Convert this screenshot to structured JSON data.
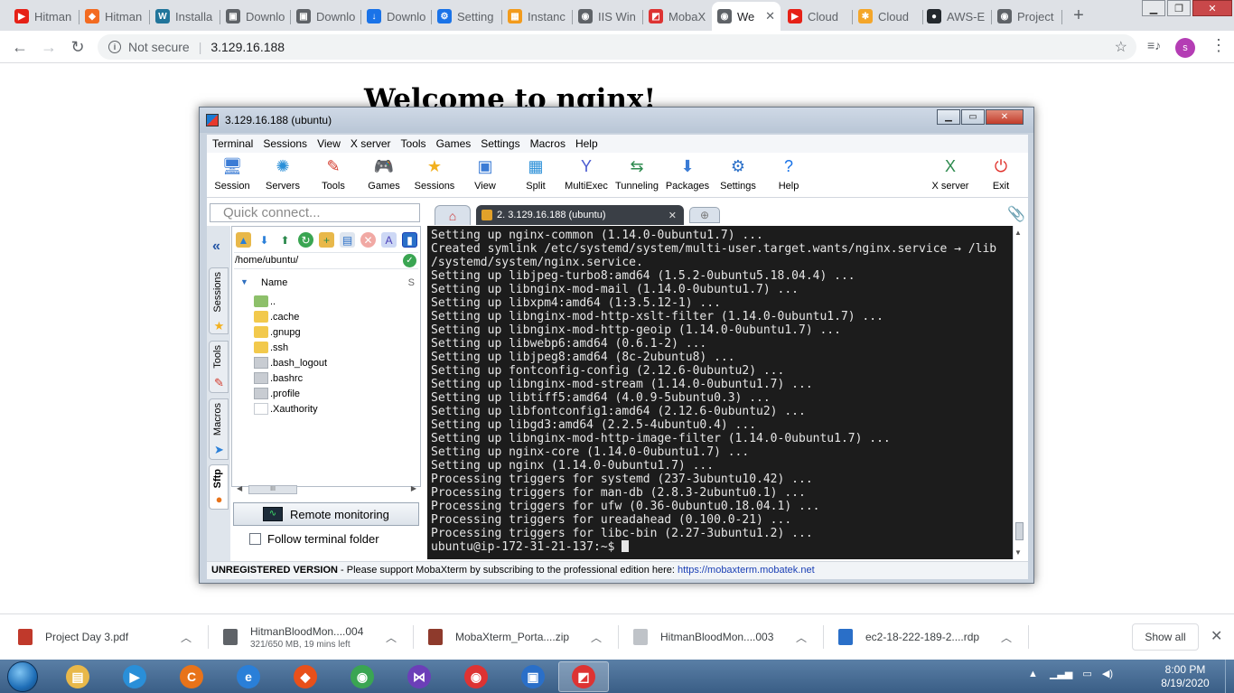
{
  "browser": {
    "tabs": [
      {
        "title": "Hitman",
        "color": "#e62117",
        "glyph": "▶"
      },
      {
        "title": "Hitman",
        "color": "#f36b21",
        "glyph": "◆"
      },
      {
        "title": "Installa",
        "color": "#21759b",
        "glyph": "W"
      },
      {
        "title": "Downlo",
        "color": "#5f6368",
        "glyph": "▣"
      },
      {
        "title": "Downlo",
        "color": "#5f6368",
        "glyph": "▣"
      },
      {
        "title": "Downlo",
        "color": "#1a73e8",
        "glyph": "↓"
      },
      {
        "title": "Setting",
        "color": "#1a73e8",
        "glyph": "⚙"
      },
      {
        "title": "Instanc",
        "color": "#f29b1d",
        "glyph": "▦"
      },
      {
        "title": "IIS Win",
        "color": "#5f6368",
        "glyph": "◉"
      },
      {
        "title": "MobaX",
        "color": "#d33",
        "glyph": "◩"
      },
      {
        "title": "We",
        "color": "#5f6368",
        "glyph": "◉",
        "active": true
      },
      {
        "title": "Cloud",
        "color": "#e62117",
        "glyph": "▶"
      },
      {
        "title": "Cloud",
        "color": "#f4a62a",
        "glyph": "✱"
      },
      {
        "title": "AWS-E",
        "color": "#24292e",
        "glyph": "●"
      },
      {
        "title": "Project",
        "color": "#5f6368",
        "glyph": "◉"
      }
    ],
    "active_tab_close": "✕",
    "new_tab": "+",
    "security": "Not secure",
    "url": "3.129.16.188",
    "avatar_letter": "s"
  },
  "page": {
    "heading": "Welcome to nginx!"
  },
  "mobaxterm": {
    "title": "3.129.16.188 (ubuntu)",
    "menu": [
      "Terminal",
      "Sessions",
      "View",
      "X server",
      "Tools",
      "Games",
      "Settings",
      "Macros",
      "Help"
    ],
    "ribbon": [
      {
        "label": "Session",
        "icon": "monitor-icon",
        "color": "#3a7bd5",
        "glyph": "🖥"
      },
      {
        "label": "Servers",
        "icon": "servers-icon",
        "color": "#2a8fd8",
        "glyph": "✺"
      },
      {
        "label": "Tools",
        "icon": "tools-icon",
        "color": "#d33a2c",
        "glyph": "✎"
      },
      {
        "label": "Games",
        "icon": "gamepad-icon",
        "color": "#667",
        "glyph": "🎮"
      },
      {
        "label": "Sessions",
        "icon": "star-icon",
        "color": "#f2b01e",
        "glyph": "★"
      },
      {
        "label": "View",
        "icon": "view-icon",
        "color": "#3a7bd5",
        "glyph": "▣"
      },
      {
        "label": "Split",
        "icon": "split-icon",
        "color": "#2a8fd8",
        "glyph": "▦"
      },
      {
        "label": "MultiExec",
        "icon": "multiexec-icon",
        "color": "#4a5bd0",
        "glyph": "Y"
      },
      {
        "label": "Tunneling",
        "icon": "tunneling-icon",
        "color": "#2d8a4e",
        "glyph": "⇆"
      },
      {
        "label": "Packages",
        "icon": "packages-icon",
        "color": "#3a7bd5",
        "glyph": "⬇"
      },
      {
        "label": "Settings",
        "icon": "settings-icon",
        "color": "#2a6fc8",
        "glyph": "⚙"
      },
      {
        "label": "Help",
        "icon": "help-icon",
        "color": "#1a73e8",
        "glyph": "?"
      },
      {
        "label": "X server",
        "icon": "xserver-icon",
        "color": "#2d8a4e",
        "glyph": "X"
      },
      {
        "label": "Exit",
        "icon": "power-icon",
        "color": "#e0302a",
        "glyph": "⏻"
      }
    ],
    "quick_connect_placeholder": "Quick connect...",
    "session_tab": "2. 3.129.16.188 (ubuntu)",
    "vertical_tabs": [
      "Sessions",
      "Tools",
      "Macros",
      "Sftp"
    ],
    "sftp": {
      "path": "/home/ubuntu/",
      "column_name": "Name",
      "column_size": "S",
      "files": [
        {
          "name": "..",
          "type": "up"
        },
        {
          "name": ".cache",
          "type": "folder"
        },
        {
          "name": ".gnupg",
          "type": "folder"
        },
        {
          "name": ".ssh",
          "type": "folder"
        },
        {
          "name": ".bash_logout",
          "type": "file"
        },
        {
          "name": ".bashrc",
          "type": "file"
        },
        {
          "name": ".profile",
          "type": "file"
        },
        {
          "name": ".Xauthority",
          "type": "blank"
        }
      ],
      "scroll_thumb": "III"
    },
    "remote_monitoring": "Remote monitoring",
    "follow_terminal_folder": "Follow terminal folder",
    "terminal_lines": [
      "Setting up nginx-common (1.14.0-0ubuntu1.7) ...",
      "Created symlink /etc/systemd/system/multi-user.target.wants/nginx.service → /lib",
      "/systemd/system/nginx.service.",
      "Setting up libjpeg-turbo8:amd64 (1.5.2-0ubuntu5.18.04.4) ...",
      "Setting up libnginx-mod-mail (1.14.0-0ubuntu1.7) ...",
      "Setting up libxpm4:amd64 (1:3.5.12-1) ...",
      "Setting up libnginx-mod-http-xslt-filter (1.14.0-0ubuntu1.7) ...",
      "Setting up libnginx-mod-http-geoip (1.14.0-0ubuntu1.7) ...",
      "Setting up libwebp6:amd64 (0.6.1-2) ...",
      "Setting up libjpeg8:amd64 (8c-2ubuntu8) ...",
      "Setting up fontconfig-config (2.12.6-0ubuntu2) ...",
      "Setting up libnginx-mod-stream (1.14.0-0ubuntu1.7) ...",
      "Setting up libtiff5:amd64 (4.0.9-5ubuntu0.3) ...",
      "Setting up libfontconfig1:amd64 (2.12.6-0ubuntu2) ...",
      "Setting up libgd3:amd64 (2.2.5-4ubuntu0.4) ...",
      "Setting up libnginx-mod-http-image-filter (1.14.0-0ubuntu1.7) ...",
      "Setting up nginx-core (1.14.0-0ubuntu1.7) ...",
      "Setting up nginx (1.14.0-0ubuntu1.7) ...",
      "Processing triggers for systemd (237-3ubuntu10.42) ...",
      "Processing triggers for man-db (2.8.3-2ubuntu0.1) ...",
      "Processing triggers for ufw (0.36-0ubuntu0.18.04.1) ...",
      "Processing triggers for ureadahead (0.100.0-21) ...",
      "Processing triggers for libc-bin (2.27-3ubuntu1.2) ..."
    ],
    "prompt": "ubuntu@ip-172-31-21-137:~$ ",
    "footer_bold": "UNREGISTERED VERSION",
    "footer_text": "  -  Please support MobaXterm by subscribing to the professional edition here:  ",
    "footer_link": "https://mobaxterm.mobatek.net"
  },
  "downloads": {
    "items": [
      {
        "name": "Project Day 3.pdf",
        "sub": "",
        "color": "#c0392b"
      },
      {
        "name": "HitmanBloodMon....004",
        "sub": "321/650 MB, 19 mins left",
        "color": "#5f6368"
      },
      {
        "name": "MobaXterm_Porta....zip",
        "sub": "",
        "color": "#8e3a2c"
      },
      {
        "name": "HitmanBloodMon....003",
        "sub": "",
        "color": "#bfc3c8"
      },
      {
        "name": "ec2-18-222-189-2....rdp",
        "sub": "",
        "color": "#2a6fc8"
      }
    ],
    "show_all": "Show all"
  },
  "taskbar": {
    "apps": [
      {
        "name": "explorer",
        "color": "#e8b84a",
        "glyph": "▤"
      },
      {
        "name": "media-player",
        "color": "#2a8fd8",
        "glyph": "▶"
      },
      {
        "name": "ccleaner",
        "color": "#e8731a",
        "glyph": "C"
      },
      {
        "name": "internet-explorer",
        "color": "#2a7fd8",
        "glyph": "e"
      },
      {
        "name": "brave",
        "color": "#e8501a",
        "glyph": "◆"
      },
      {
        "name": "chrome",
        "color": "#3aa552",
        "glyph": "◉"
      },
      {
        "name": "visual-studio",
        "color": "#6c3fb8",
        "glyph": "⋈"
      },
      {
        "name": "chrome-profile",
        "color": "#d33",
        "glyph": "◉"
      },
      {
        "name": "remote-desktop",
        "color": "#2a6fc8",
        "glyph": "▣"
      },
      {
        "name": "mobaxterm",
        "color": "#d33",
        "glyph": "◩"
      }
    ],
    "time": "8:00 PM",
    "date": "8/19/2020"
  }
}
